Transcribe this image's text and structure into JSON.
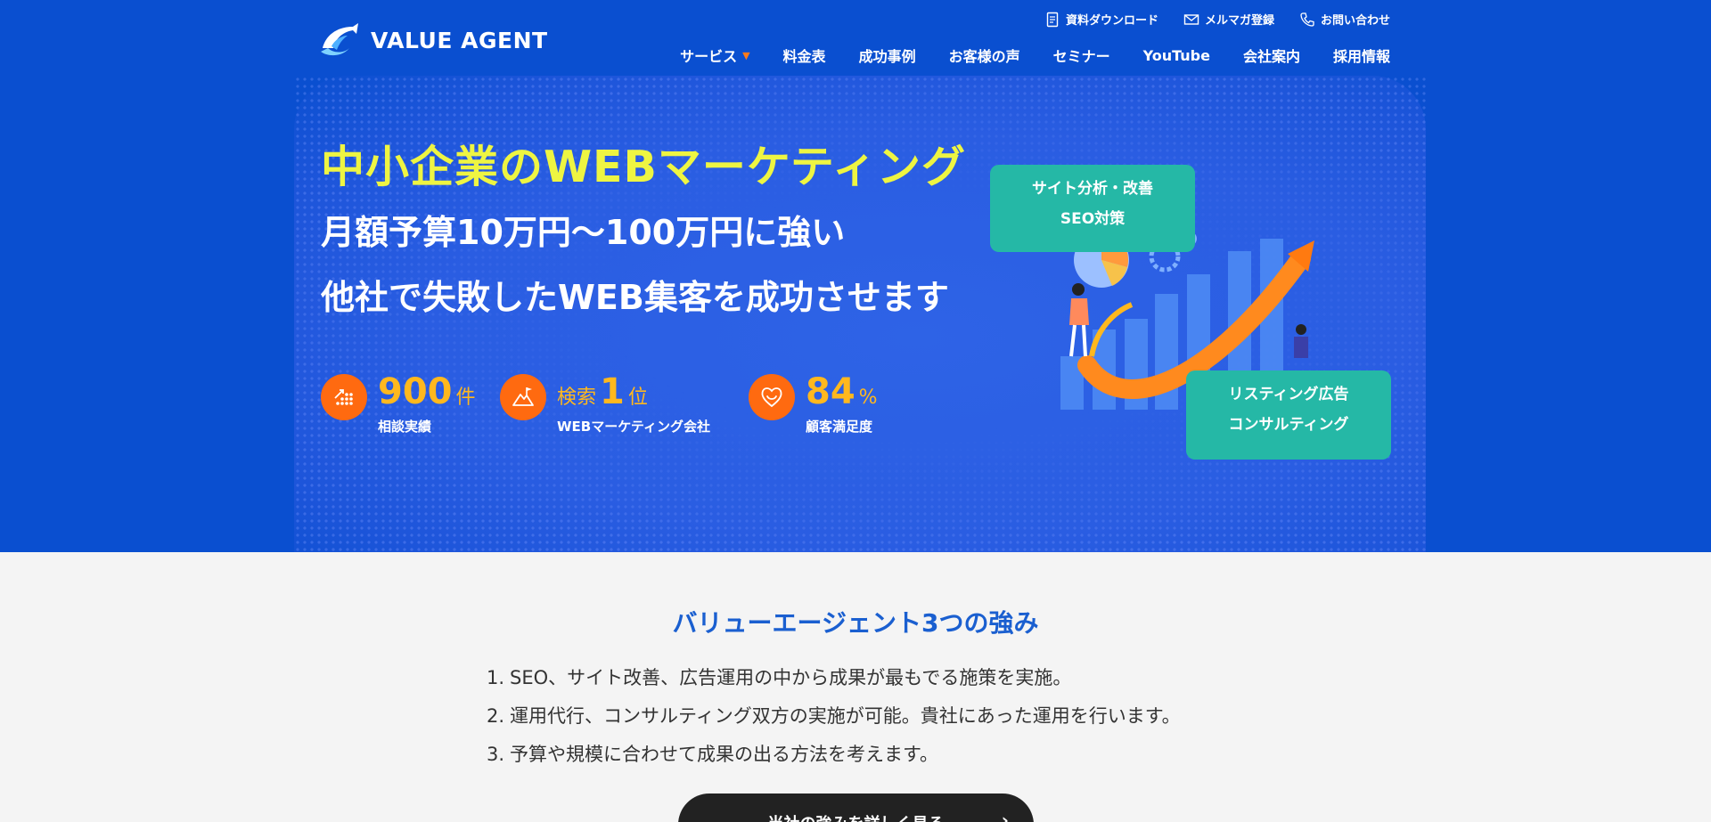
{
  "brand": {
    "name": "VALUE AGENT"
  },
  "utility_nav": [
    {
      "label": "資料ダウンロード",
      "icon": "document-icon"
    },
    {
      "label": "メルマガ登録",
      "icon": "mail-icon"
    },
    {
      "label": "お問い合わせ",
      "icon": "phone-icon"
    }
  ],
  "main_nav": [
    {
      "label": "サービス",
      "has_dropdown": true
    },
    {
      "label": "料金表"
    },
    {
      "label": "成功事例"
    },
    {
      "label": "お客様の声"
    },
    {
      "label": "セミナー"
    },
    {
      "label": "YouTube"
    },
    {
      "label": "会社案内"
    },
    {
      "label": "採用情報"
    }
  ],
  "hero": {
    "headline": "中小企業のWEBマーケティング",
    "line2": "月額予算10万円～100万円に強い",
    "line3": "他社で失敗したWEB集客を成功させます",
    "stats": [
      {
        "prefix": "",
        "value": "900",
        "unit": "件",
        "label": "相談実績",
        "icon": "chart-dots-icon"
      },
      {
        "prefix": "検索",
        "value": "1",
        "unit": "位",
        "label": "WEBマーケティング会社",
        "icon": "mountain-flag-icon"
      },
      {
        "prefix": "",
        "value": "84",
        "unit": "%",
        "label": "顧客満足度",
        "icon": "smile-heart-icon"
      }
    ],
    "tags": [
      {
        "line1": "サイト分析・改善",
        "line2": "SEO対策"
      },
      {
        "line1": "リスティング広告",
        "line2": "コンサルティング"
      }
    ]
  },
  "strengths": {
    "title": "バリューエージェント3つの強み",
    "items": [
      {
        "num": "1.",
        "text": "SEO、サイト改善、広告運用の中から成果が最もでる施策を実施。"
      },
      {
        "num": "2.",
        "text": "運用代行、コンサルティング双方の実施が可能。貴社にあった運用を行います。"
      },
      {
        "num": "3.",
        "text": "予算や規模に合わせて成果の出る方法を考えます。"
      }
    ]
  },
  "cta": {
    "label": "当社の強みを詳しく見る"
  },
  "colors": {
    "primary_blue": "#0a4fd0",
    "accent_yellow": "#eef542",
    "stat_orange": "#ff6a10",
    "stat_gold": "#ffb81e",
    "tag_teal": "#25b8a6",
    "section_title_blue": "#1a5fd0"
  }
}
